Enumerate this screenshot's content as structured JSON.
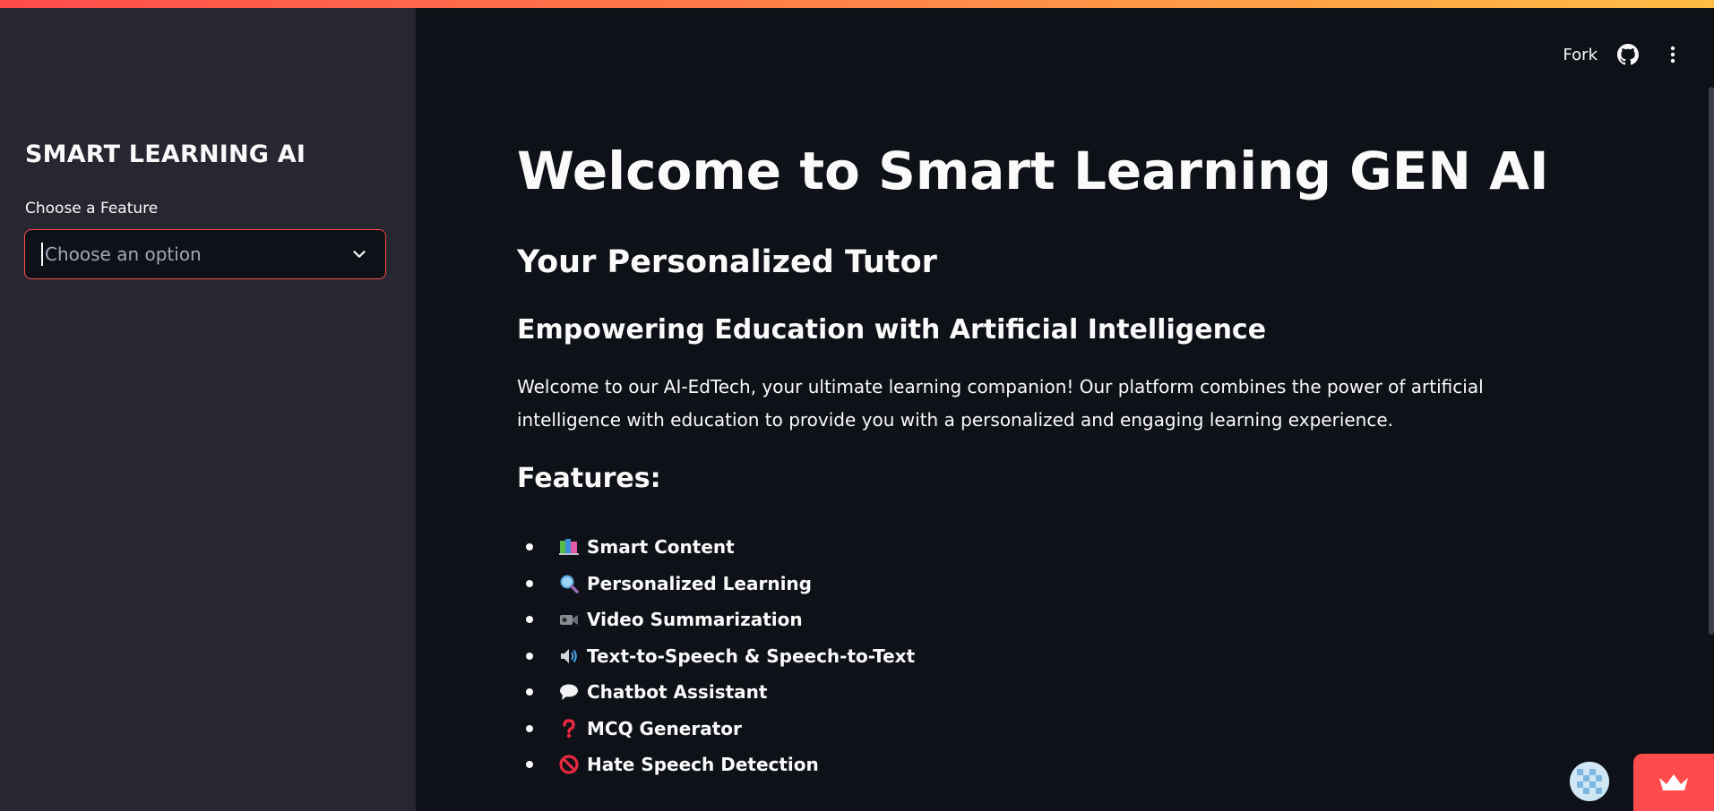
{
  "sidebar": {
    "title": "SMART LEARNING AI",
    "select_label": "Choose a Feature",
    "select_placeholder": "Choose an option"
  },
  "header": {
    "fork_label": "Fork"
  },
  "main": {
    "title": "Welcome to Smart Learning GEN AI",
    "subtitle": "Your Personalized Tutor",
    "tagline": "Empowering Education with Artificial Intelligence",
    "intro": "Welcome to our AI-EdTech, your ultimate learning companion! Our platform combines the power of artificial intelligence with education to provide you with a personalized and engaging learning experience.",
    "features_title": "Features:",
    "features": [
      {
        "label": "Smart Content",
        "icon": "books-icon"
      },
      {
        "label": "Personalized Learning",
        "icon": "magnifier-icon"
      },
      {
        "label": "Video Summarization",
        "icon": "video-camera-icon"
      },
      {
        "label": "Text-to-Speech & Speech-to-Text",
        "icon": "speaker-icon"
      },
      {
        "label": "Chatbot Assistant",
        "icon": "speech-bubble-icon"
      },
      {
        "label": "MCQ Generator",
        "icon": "question-mark-icon"
      },
      {
        "label": "Hate Speech Detection",
        "icon": "prohibited-icon"
      }
    ]
  },
  "colors": {
    "background": "#0e1117",
    "sidebar": "#262730",
    "accent": "#ff4b4b",
    "text": "#fafafa"
  }
}
